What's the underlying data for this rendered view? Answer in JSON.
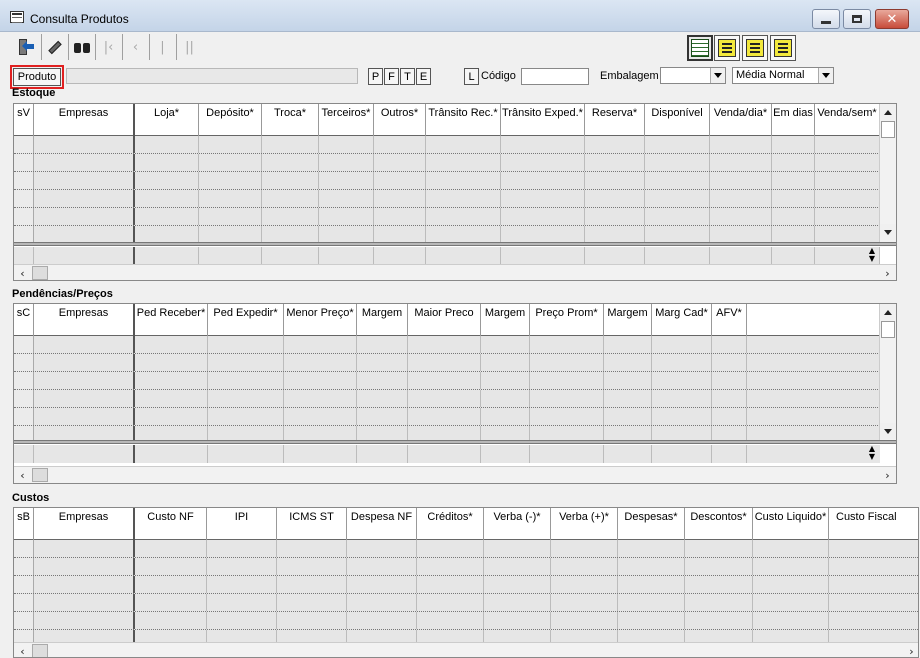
{
  "window": {
    "title": "Consulta Produtos"
  },
  "toolbar": {
    "icons": [
      "exit-icon",
      "eraser-icon",
      "binoculars-icon",
      "first-icon",
      "prev-icon",
      "next-icon",
      "last-icon"
    ],
    "view_icons": [
      "grid-view-icon",
      "view-a-icon",
      "view-b-icon",
      "view-c-icon"
    ]
  },
  "search": {
    "produto_label": "Produto",
    "filters": [
      "P",
      "F",
      "T",
      "E"
    ],
    "l_label": "L",
    "codigo_label": "Código",
    "codigo_value": "",
    "embalagem_label": "Embalagem",
    "embalagem_value": "",
    "media_value": "Média Normal"
  },
  "estoque": {
    "title": "Estoque",
    "columns": [
      "sV",
      "Empresas",
      "Loja*",
      "Depósito*",
      "Troca*",
      "Terceiros*",
      "Outros*",
      "Trânsito Rec.*",
      "Trânsito Exped.*",
      "Reserva*",
      "Disponível",
      "Venda/dia*",
      "Em dias",
      "Venda/sem*"
    ]
  },
  "pendencias": {
    "title": "Pendências/Preços",
    "columns": [
      "sC",
      "Empresas",
      "Ped Receber*",
      "Ped Expedir*",
      "Menor Preço*",
      "Margem",
      "Maior Preco",
      "Margem",
      "Preço Prom*",
      "Margem",
      "Marg Cad*",
      "AFV*"
    ]
  },
  "custos": {
    "title": "Custos",
    "columns": [
      "sB",
      "Empresas",
      "Custo NF",
      "IPI",
      "ICMS ST",
      "Despesa NF",
      "Créditos*",
      "Verba (-)*",
      "Verba (+)*",
      "Despesas*",
      "Descontos*",
      "Custo Liquido*",
      "Custo Fiscal"
    ]
  }
}
